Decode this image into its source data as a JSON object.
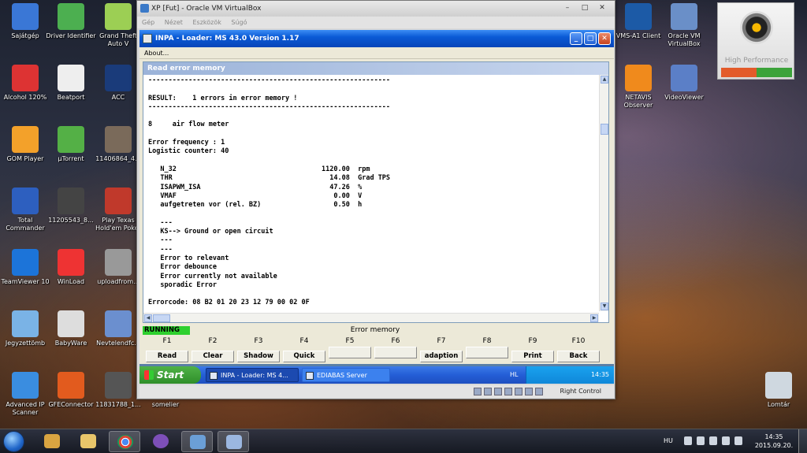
{
  "desktop": {
    "icons": [
      {
        "label": "Sajátgép",
        "color": "#3a77d6"
      },
      {
        "label": "Driver Identifier",
        "color": "#4caf50"
      },
      {
        "label": "Grand Theft Auto V",
        "color": "#9ccf54"
      },
      {
        "label": "Alcohol 120%",
        "color": "#d33"
      },
      {
        "label": "Beatport",
        "color": "#eeeeee"
      },
      {
        "label": "ACC",
        "color": "#1a3b7a"
      },
      {
        "label": "GOM Player",
        "color": "#f3a12a"
      },
      {
        "label": "µTorrent",
        "color": "#54b046"
      },
      {
        "label": "11406864_4...",
        "color": "#7a6a5a"
      },
      {
        "label": "Total Commander",
        "color": "#2d5fbf"
      },
      {
        "label": "11205543_8...",
        "color": "#444444"
      },
      {
        "label": "Play Texas Hold'em Poker",
        "color": "#c0392b"
      },
      {
        "label": "TeamViewer 10",
        "color": "#1c74d9"
      },
      {
        "label": "WinLoad",
        "color": "#e33"
      },
      {
        "label": "uploadfrom...",
        "color": "#999999"
      },
      {
        "label": "Jegyzettömb",
        "color": "#7ab3e6"
      },
      {
        "label": "BabyWare",
        "color": "#dddddd"
      },
      {
        "label": "Nevtelendfc...",
        "color": "#6b8fcf"
      },
      {
        "label": "Advanced IP Scanner",
        "color": "#3a8de0"
      },
      {
        "label": "GFEConnector",
        "color": "#e25b1e"
      },
      {
        "label": "11831788_1...",
        "color": "#555555"
      },
      {
        "label": "somelier",
        "color": "#00000000"
      },
      {
        "label": "VMS-A1 Client",
        "color": "#1c5aa6"
      },
      {
        "label": "Oracle VM VirtualBox",
        "color": "#6a8fc8"
      },
      {
        "label": "NETAVIS Observer",
        "color": "#f08a1c"
      },
      {
        "label": "VideoViewer",
        "color": "#5b7fc7"
      },
      {
        "label": "Lomtár",
        "color": "#cfd8e0"
      }
    ],
    "high_performance_label": "High Performance"
  },
  "vbox": {
    "title": "XP [Fut] - Oracle VM VirtualBox",
    "menu": [
      "Gép",
      "Nézet",
      "Eszközök",
      "Súgó"
    ],
    "status_right_control": "Right Control"
  },
  "inpa": {
    "title": "INPA - Loader:  MS 43.0 Version 1.17",
    "menu_about": "About...",
    "panel_title": "Read error memory",
    "console_lines": [
      "------------------------------------------------------------",
      "",
      "RESULT:    1 errors in error memory !",
      "------------------------------------------------------------",
      "",
      "8     air flow meter",
      "",
      "Error frequency : 1",
      "Logistic counter: 40",
      "",
      "   N_32                                    1120.00  rpm",
      "   THR                                       14.08  Grad TPS",
      "   ISAPWM_ISA                                47.26  %",
      "   VMAF                                       0.00  V",
      "   aufgetreten vor (rel. BZ)                  0.50  h",
      "",
      "   ---",
      "   KS--> Ground or open circuit",
      "   ---",
      "   ---",
      "   Error to relevant",
      "   Error debounce",
      "   Error currently not available",
      "   sporadic Error",
      "",
      "Errorcode: 08 B2 01 20 23 12 79 00 02 0F",
      "------------------------------------------------------------"
    ],
    "status": "RUNNING",
    "fbar_title": "Error memory",
    "fkeys": [
      {
        "key": "F1",
        "label": "Read"
      },
      {
        "key": "F2",
        "label": "Clear"
      },
      {
        "key": "F3",
        "label": "Shadow"
      },
      {
        "key": "F4",
        "label": "Quick"
      },
      {
        "key": "F5",
        "label": ""
      },
      {
        "key": "F6",
        "label": ""
      },
      {
        "key": "F7",
        "label": "adaption"
      },
      {
        "key": "F8",
        "label": ""
      },
      {
        "key": "F9",
        "label": "Print"
      },
      {
        "key": "F10",
        "label": "Back"
      }
    ]
  },
  "xp_taskbar": {
    "start_label": "Start",
    "task1": "INPA - Loader:  MS 4...",
    "task2": "EDIABAS Server",
    "lang": "HL",
    "clock": "14:35"
  },
  "win7_taskbar": {
    "lang": "HU",
    "time": "14:35",
    "date": "2015.09.20."
  }
}
